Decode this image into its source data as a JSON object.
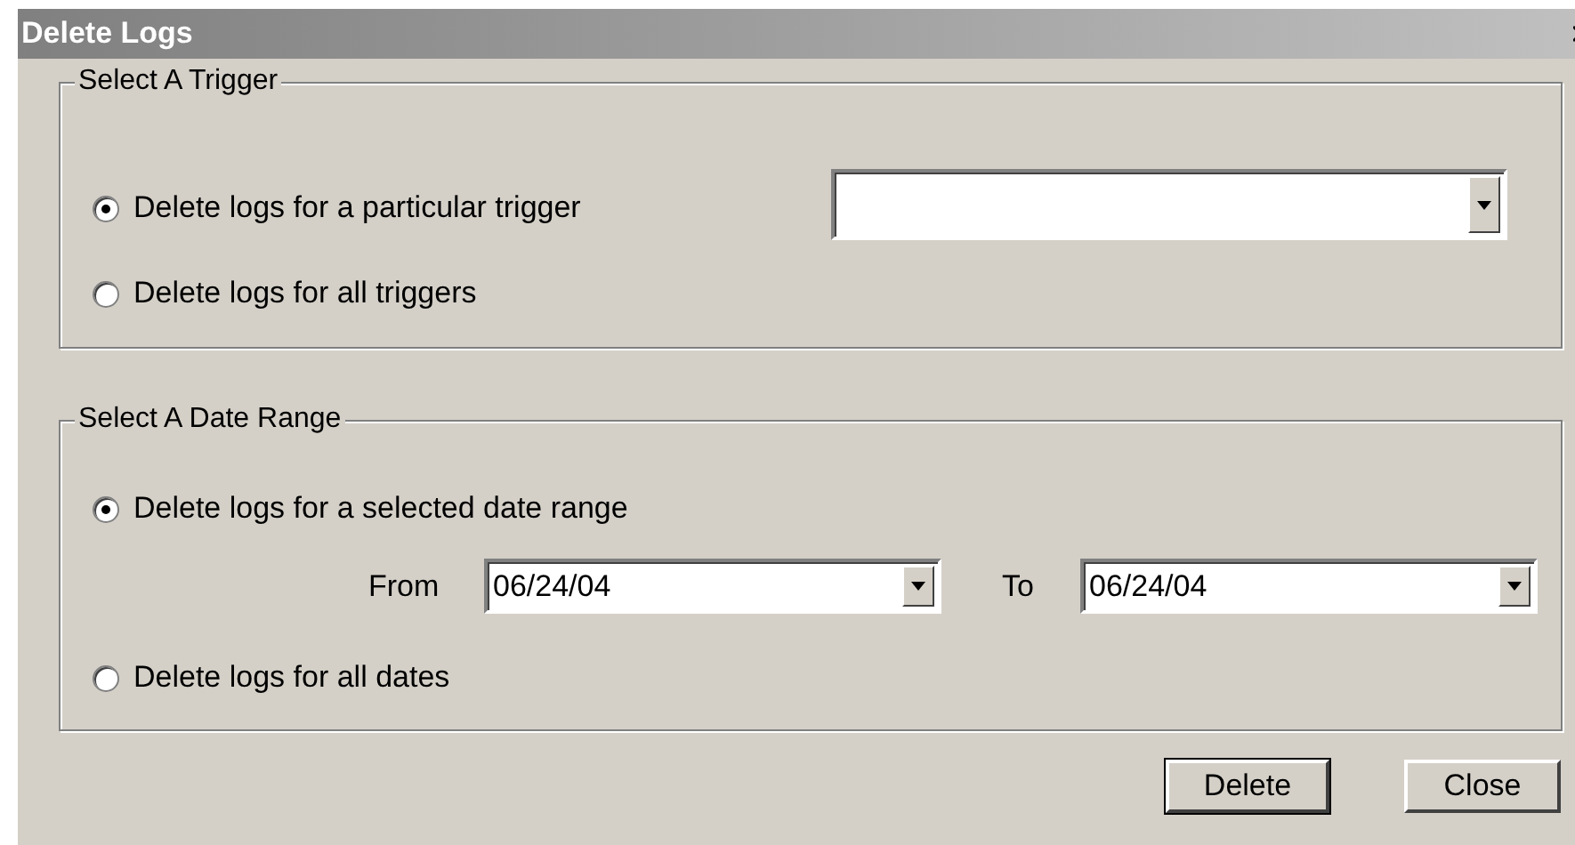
{
  "window": {
    "title": "Delete Logs"
  },
  "trigger_group": {
    "legend": "Select A Trigger",
    "options": [
      {
        "label": "Delete logs for a particular trigger",
        "selected": true
      },
      {
        "label": "Delete logs for all triggers",
        "selected": false
      }
    ]
  },
  "date_group": {
    "legend": "Select A Date Range",
    "options": [
      {
        "label": "Delete logs for a selected date range",
        "selected": true
      },
      {
        "label": "Delete logs for all dates",
        "selected": false
      }
    ],
    "from_label": "From",
    "from_value": "06/24/04",
    "to_label": "To",
    "to_value": "06/24/04"
  },
  "buttons": [
    {
      "label": "Delete",
      "default": true
    },
    {
      "label": "Close",
      "default": false
    }
  ]
}
